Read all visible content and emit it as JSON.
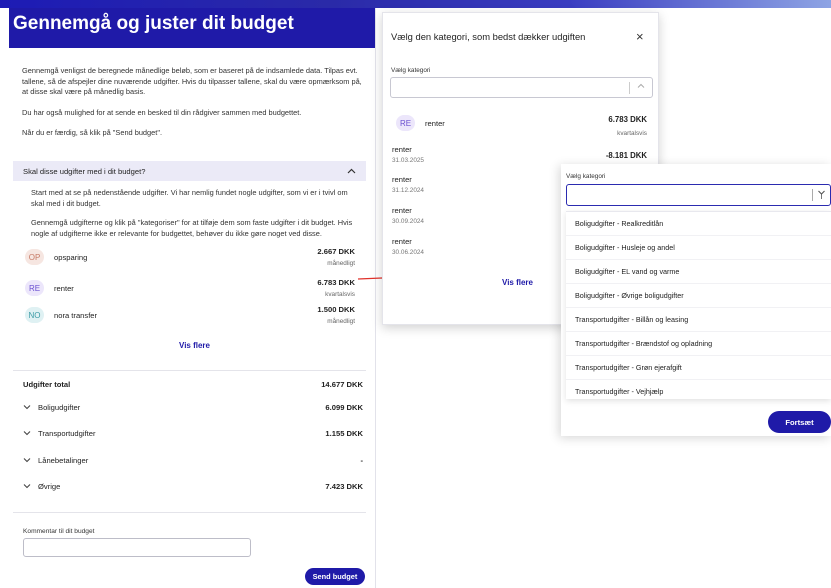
{
  "page": {
    "title": "Gennemgå og juster dit budget",
    "intro": [
      "Gennemgå venligst de beregnede månedlige beløb, som er baseret på de indsamlede data. Tilpas evt. tallene, så de afspejler dine nuværende udgifter. Hvis du tilpasser tallene, skal du være opmærksom på, at disse skal være på månedlig basis.",
      "Du har også mulighed for at sende en besked til din rådgiver sammen med budgettet.",
      "Når du er færdig, så klik på \"Send budget\"."
    ]
  },
  "accordion": {
    "title": "Skal disse udgifter med i dit budget?",
    "chevron": "chevron-up-icon",
    "body": [
      "Start med at se på nedenstående udgifter. Vi har nemlig fundet nogle udgifter, som vi er i tvivl om skal med i dit budget.",
      "Gennemgå udgifterne og klik på \"kategoriser\" for at tilføje dem som faste udgifter i dit budget. Hvis nogle af udgifterne ikke er relevante for budgettet, behøver du ikke gøre noget ved disse."
    ],
    "items": [
      {
        "initials": "OP",
        "name": "opsparing",
        "amount": "2.667 DKK",
        "freq": "månedligt",
        "bg": "#f6e6e1",
        "fg": "#c77a66"
      },
      {
        "initials": "RE",
        "name": "renter",
        "amount": "6.783 DKK",
        "freq": "kvartalsvis",
        "bg": "#ece6fb",
        "fg": "#6a4fd0"
      },
      {
        "initials": "NO",
        "name": "nora transfer",
        "amount": "1.500 DKK",
        "freq": "månedligt",
        "bg": "#dff1f3",
        "fg": "#3b9aa5"
      }
    ],
    "show_more": "Vis flere"
  },
  "totals": {
    "label": "Udgifter total",
    "amount": "14.677 DKK",
    "categories": [
      {
        "label": "Boligudgifter",
        "amount": "6.099 DKK"
      },
      {
        "label": "Transportudgifter",
        "amount": "1.155 DKK"
      },
      {
        "label": "Lånebetalinger",
        "amount": "-"
      },
      {
        "label": "Øvrige",
        "amount": "7.423 DKK"
      }
    ]
  },
  "comment": {
    "label": "Kommentar til dit budget",
    "value": ""
  },
  "send_button": "Send budget",
  "modal": {
    "title": "Vælg den kategori, som bedst dækker udgiften",
    "close": "×",
    "select_label": "Vælg kategori",
    "main": {
      "initials": "RE",
      "name": "renter",
      "amount": "6.783 DKK",
      "freq": "kvartalsvis"
    },
    "transactions": [
      {
        "name": "renter",
        "date": "31.03.2025",
        "amount": "-8.181 DKK"
      },
      {
        "name": "renter",
        "date": "31.12.2024",
        "amount": ""
      },
      {
        "name": "renter",
        "date": "30.09.2024",
        "amount": ""
      },
      {
        "name": "renter",
        "date": "30.06.2024",
        "amount": ""
      }
    ],
    "show_more": "Vis flere"
  },
  "dropdown": {
    "label": "Vælg kategori",
    "value": "",
    "options": [
      "Boligudgifter - Realkreditlån",
      "Boligudgifter - Husleje og andel",
      "Boligudgifter - EL vand og varme",
      "Boligudgifter - Øvrige boligudgifter",
      "Transportudgifter - Billån og leasing",
      "Transportudgifter - Brændstof og opladning",
      "Transportudgifter - Grøn ejerafgift",
      "Transportudgifter - Vejhjælp"
    ]
  },
  "continue_button": "Fortsæt",
  "colors": {
    "brand": "#1f1aa8",
    "accordion_bg": "#ebeaf7",
    "arrow": "#e0322b"
  }
}
